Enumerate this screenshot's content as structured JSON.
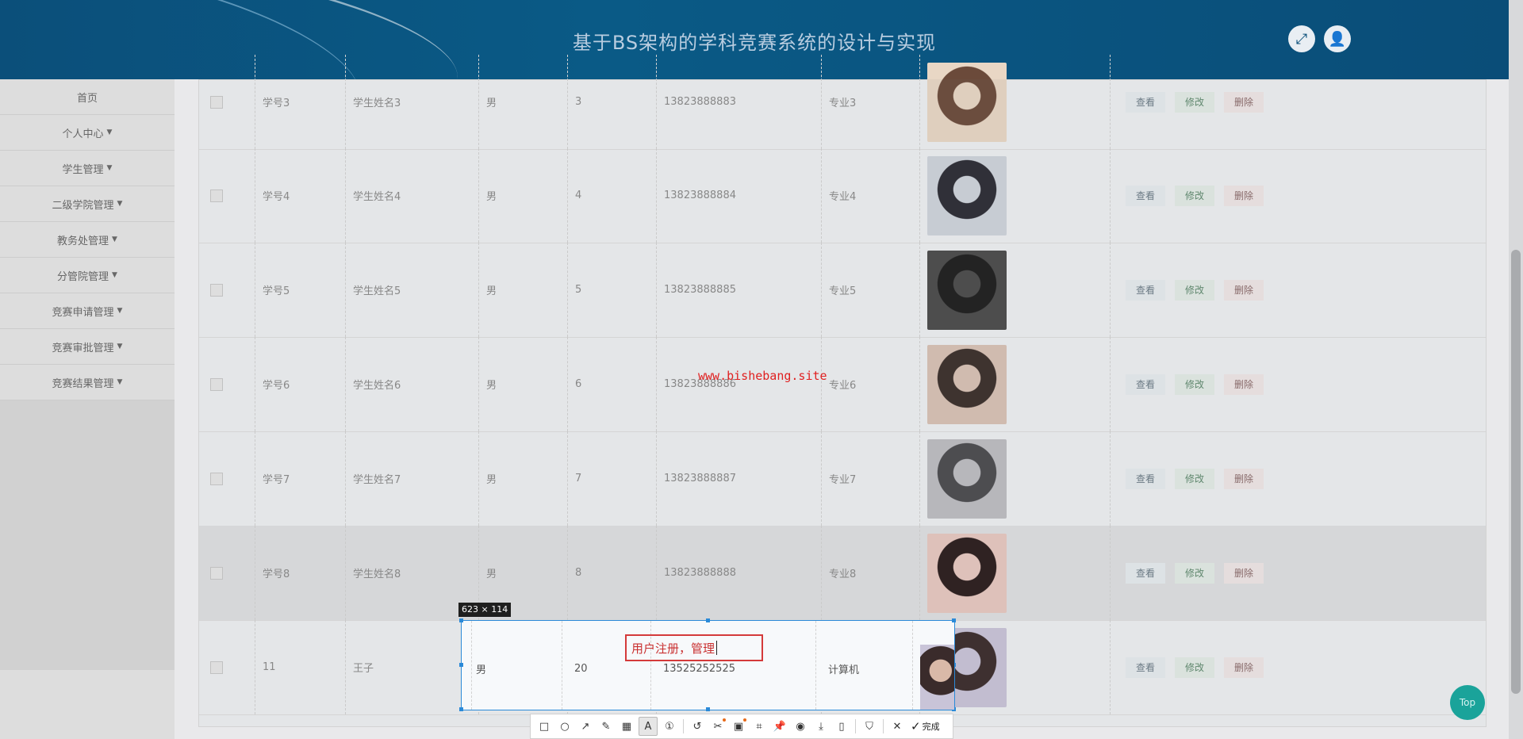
{
  "header": {
    "title": "基于BS架构的学科竞赛系统的设计与实现"
  },
  "sidebar": {
    "items": [
      {
        "label": "首页",
        "dropdown": false
      },
      {
        "label": "个人中心",
        "dropdown": true
      },
      {
        "label": "学生管理",
        "dropdown": true
      },
      {
        "label": "二级学院管理",
        "dropdown": true
      },
      {
        "label": "教务处管理",
        "dropdown": true
      },
      {
        "label": "分管院管理",
        "dropdown": true
      },
      {
        "label": "竞赛申请管理",
        "dropdown": true
      },
      {
        "label": "竞赛审批管理",
        "dropdown": true
      },
      {
        "label": "竞赛结果管理",
        "dropdown": true
      }
    ]
  },
  "table": {
    "rows": [
      {
        "id": "学号3",
        "name": "学生姓名3",
        "gender": "男",
        "age": "3",
        "phone": "13823888883",
        "major": "专业3",
        "photo_colors": [
          "#6b4a3a",
          "#e9d7c5"
        ]
      },
      {
        "id": "学号4",
        "name": "学生姓名4",
        "gender": "男",
        "age": "4",
        "phone": "13823888884",
        "major": "专业4",
        "photo_colors": [
          "#2b2b33",
          "#cfd4dc"
        ]
      },
      {
        "id": "学号5",
        "name": "学生姓名5",
        "gender": "男",
        "age": "5",
        "phone": "13823888885",
        "major": "专业5",
        "photo_colors": [
          "#1d1d1d",
          "#4a4a4a"
        ]
      },
      {
        "id": "学号6",
        "name": "学生姓名6",
        "gender": "男",
        "age": "6",
        "phone": "13823888886",
        "major": "专业6",
        "photo_colors": [
          "#3a2e2a",
          "#d8c2b5"
        ]
      },
      {
        "id": "学号7",
        "name": "学生姓名7",
        "gender": "男",
        "age": "7",
        "phone": "13823888887",
        "major": "专业7",
        "photo_colors": [
          "#4a4a4e",
          "#bdbdc2"
        ]
      },
      {
        "id": "学号8",
        "name": "学生姓名8",
        "gender": "男",
        "age": "8",
        "phone": "13823888888",
        "major": "专业8",
        "photo_colors": [
          "#2a1c1c",
          "#e8c8c0"
        ]
      },
      {
        "id": "11",
        "name": "王子",
        "gender": "男",
        "age": "20",
        "phone": "13525252525",
        "major": "计算机",
        "photo_colors": [
          "#3a2b2b",
          "#c9c4d8"
        ]
      }
    ],
    "action_labels": {
      "view": "查看",
      "edit": "修改",
      "delete": "删除"
    }
  },
  "capture": {
    "size_label": "623 × 114",
    "text_annotation": "用户注册，管理"
  },
  "watermark": "www.bishebang.site",
  "toolbar": {
    "tools": [
      {
        "icon": "rectangle-icon",
        "glyph": "□"
      },
      {
        "icon": "circle-icon",
        "glyph": "○"
      },
      {
        "icon": "arrow-icon",
        "glyph": "↗"
      },
      {
        "icon": "pen-icon",
        "glyph": "✎"
      },
      {
        "icon": "mosaic-icon",
        "glyph": "▦"
      },
      {
        "icon": "text-icon",
        "glyph": "A"
      },
      {
        "icon": "number-icon",
        "glyph": "①"
      },
      {
        "icon": "undo-icon",
        "glyph": "↺"
      },
      {
        "icon": "scissors-icon",
        "glyph": "✂"
      },
      {
        "icon": "ocr-icon",
        "glyph": "▣"
      },
      {
        "icon": "scan-icon",
        "glyph": "⌗"
      },
      {
        "icon": "pin-icon",
        "glyph": "📌"
      },
      {
        "icon": "record-icon",
        "glyph": "◉"
      },
      {
        "icon": "download-icon",
        "glyph": "⤓"
      },
      {
        "icon": "long-screenshot-icon",
        "glyph": "▯"
      },
      {
        "icon": "bookmark-icon",
        "glyph": "⛉"
      }
    ],
    "close_glyph": "✕",
    "done_label": "完成"
  },
  "top_button": "Top",
  "colors": {
    "header": "#0b4f7a",
    "accent": "#2b8ad8",
    "annotation": "#d43a3a",
    "top": "#1aa39a"
  }
}
